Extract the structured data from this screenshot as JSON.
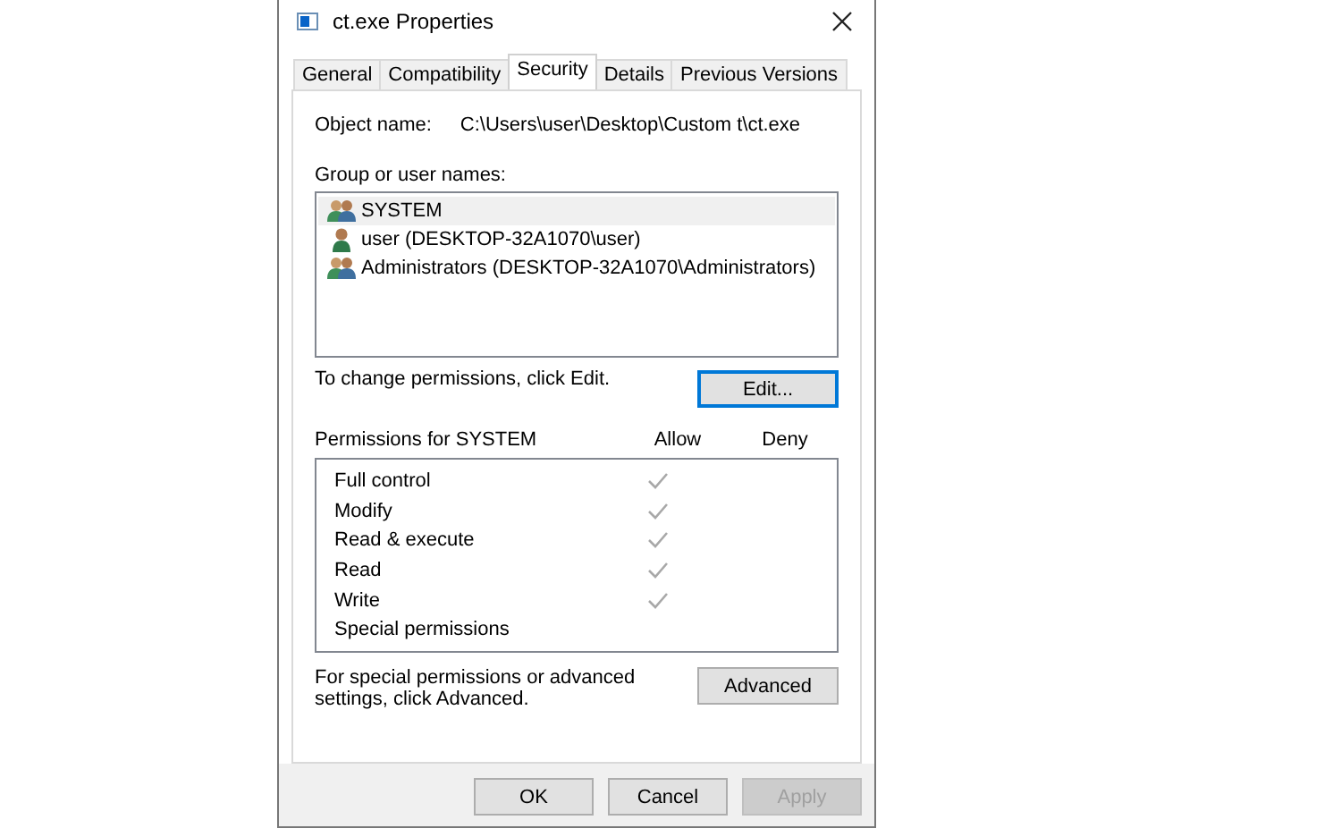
{
  "window": {
    "title": "ct.exe Properties"
  },
  "tabs": [
    {
      "label": "General",
      "selected": false
    },
    {
      "label": "Compatibility",
      "selected": false
    },
    {
      "label": "Security",
      "selected": true
    },
    {
      "label": "Details",
      "selected": false
    },
    {
      "label": "Previous Versions",
      "selected": false
    }
  ],
  "object_name": {
    "label": "Object name:",
    "value": "C:\\Users\\user\\Desktop\\Custom t\\ct.exe"
  },
  "group_label": "Group or user names:",
  "principals": [
    {
      "name": "SYSTEM",
      "kind": "group",
      "selected": true
    },
    {
      "name": "user (DESKTOP-32A1070\\user)",
      "kind": "user",
      "selected": false
    },
    {
      "name": "Administrators (DESKTOP-32A1070\\Administrators)",
      "kind": "group",
      "selected": false
    }
  ],
  "change_hint": "To change permissions, click Edit.",
  "edit_button": "Edit...",
  "permissions": {
    "title": "Permissions for SYSTEM",
    "allow_header": "Allow",
    "deny_header": "Deny",
    "rows": [
      {
        "name": "Full control",
        "allow": true,
        "deny": false
      },
      {
        "name": "Modify",
        "allow": true,
        "deny": false
      },
      {
        "name": "Read & execute",
        "allow": true,
        "deny": false
      },
      {
        "name": "Read",
        "allow": true,
        "deny": false
      },
      {
        "name": "Write",
        "allow": true,
        "deny": false
      },
      {
        "name": "Special permissions",
        "allow": false,
        "deny": false
      }
    ]
  },
  "advanced_hint": "For special permissions or advanced settings, click Advanced.",
  "advanced_button": "Advanced",
  "buttons": [
    {
      "label": "OK",
      "disabled": false
    },
    {
      "label": "Cancel",
      "disabled": false
    },
    {
      "label": "Apply",
      "disabled": true
    }
  ]
}
